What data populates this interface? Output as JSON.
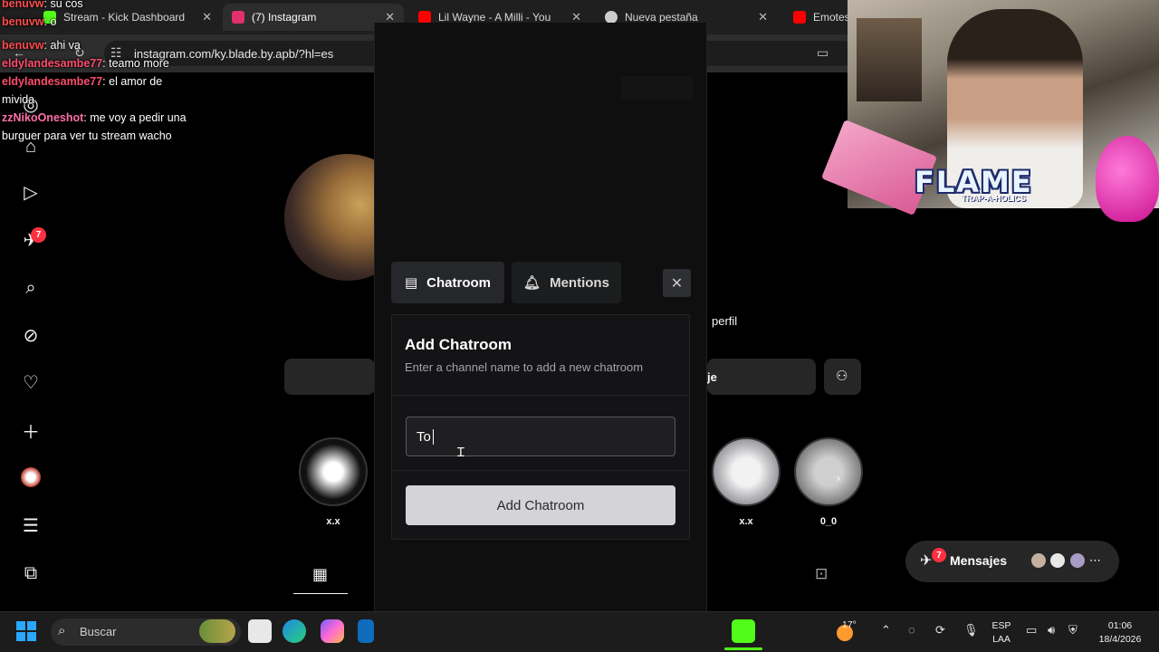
{
  "browser": {
    "tabs": [
      {
        "label": "Stream - Kick Dashboard",
        "color": "#53fc18"
      },
      {
        "label": "(7) Instagram",
        "color": "#e1306c"
      },
      {
        "label": "Lil Wayne - A Milli - You",
        "color": "#ff0000"
      },
      {
        "label": "Nueva pestaña",
        "color": "#cccccc"
      },
      {
        "label": "Emotes",
        "color": "#ff0000"
      }
    ],
    "url": "instagram.com/ky.blade.by.apb/?hl=es"
  },
  "chat": {
    "messages": [
      {
        "user": "benuvw",
        "text": ": su cos",
        "color": "#ff4d4d"
      },
      {
        "user": "benuvw",
        "text": ": o",
        "color": "#ff4d4d"
      },
      {
        "user": "benuvw",
        "text": ": ahi va",
        "color": "#ff4d4d"
      },
      {
        "user": "eldylandesambe77",
        "text": ": teamo more",
        "color": "#ff4d6d"
      },
      {
        "user": "eldylandesambe77",
        "text": ": el amor de mivida",
        "color": "#ff4d6d"
      },
      {
        "user": "zzNikoOneshot",
        "text": ": me voy a pedir una burguer para ver tu stream wacho",
        "color": "#ff6fa8"
      }
    ]
  },
  "instagram": {
    "notif_count": "7",
    "profile_text": "perfil",
    "message_btn_fragment": "je",
    "highlights": [
      {
        "label": "x.x"
      },
      {
        "label": "x.x"
      },
      {
        "label": "0_0"
      }
    ],
    "messages_label": "Mensajes",
    "messages_count": "7"
  },
  "cam": {
    "title": "FLAME",
    "subtitle": "TRAP-A-HOLICS"
  },
  "kick_panel": {
    "tab_chatroom": "Chatroom",
    "tab_mentions": "Mentions",
    "card_title": "Add Chatroom",
    "card_subtitle": "Enter a channel name to add a new chatroom",
    "input_value": "To",
    "add_button": "Add Chatroom"
  },
  "taskbar": {
    "search_placeholder": "Buscar",
    "weather": "17°",
    "lang_line1": "ESP",
    "lang_line2": "LAA",
    "time": "01:06",
    "date": "18/4/2026"
  }
}
